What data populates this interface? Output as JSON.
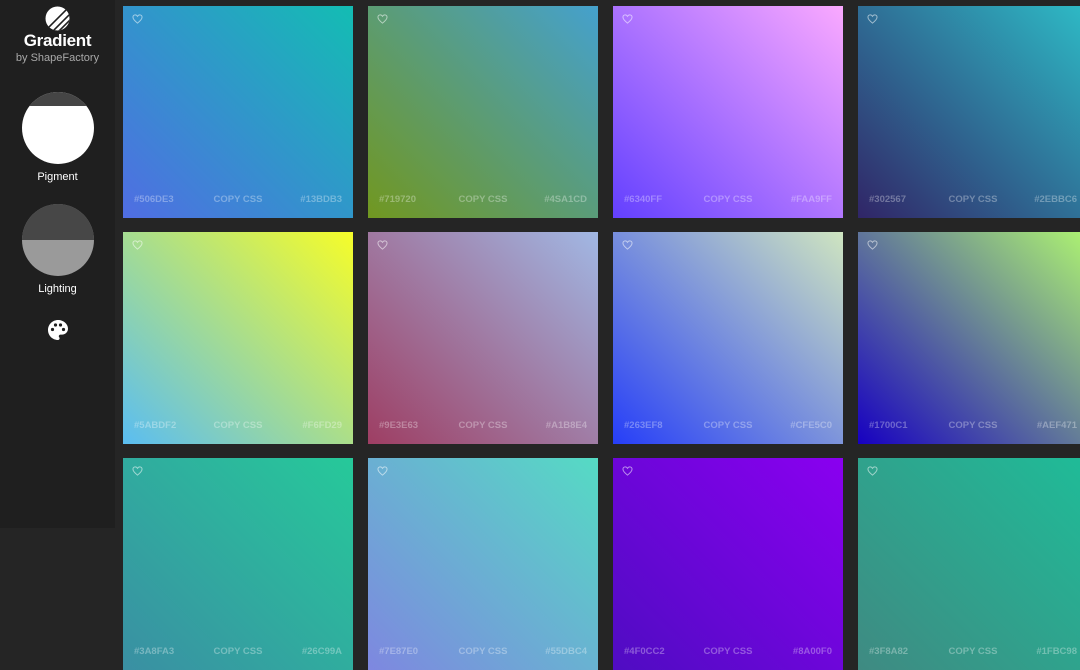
{
  "brand": {
    "title": "Gradient",
    "byline": "by ShapeFactory"
  },
  "controls": {
    "pigment_label": "Pigment",
    "lighting_label": "Lighting"
  },
  "copy_label": "COPY CSS",
  "cards": [
    {
      "c1": "#506DE3",
      "c2": "#13BDB3",
      "angle": "45deg"
    },
    {
      "c1": "#719720",
      "c2": "#4SA1CD",
      "angle": "45deg"
    },
    {
      "c1": "#6340FF",
      "c2": "#FAA9FF",
      "angle": "45deg"
    },
    {
      "c1": "#302567",
      "c2": "#2EBBC6",
      "angle": "45deg"
    },
    {
      "c1": "#5ABDF2",
      "c2": "#F6FD29",
      "angle": "45deg"
    },
    {
      "c1": "#9E3E63",
      "c2": "#A1B8E4",
      "angle": "45deg"
    },
    {
      "c1": "#263EF8",
      "c2": "#CFE5C0",
      "angle": "45deg"
    },
    {
      "c1": "#1700C1",
      "c2": "#AEF471",
      "angle": "45deg"
    },
    {
      "c1": "#3A8FA3",
      "c2": "#26C99A",
      "angle": "45deg"
    },
    {
      "c1": "#7E87E0",
      "c2": "#55DBC4",
      "angle": "45deg"
    },
    {
      "c1": "#4F0CC2",
      "c2": "#8A00F0",
      "angle": "45deg"
    },
    {
      "c1": "#3F8A82",
      "c2": "#1FBC98",
      "angle": "45deg"
    }
  ]
}
